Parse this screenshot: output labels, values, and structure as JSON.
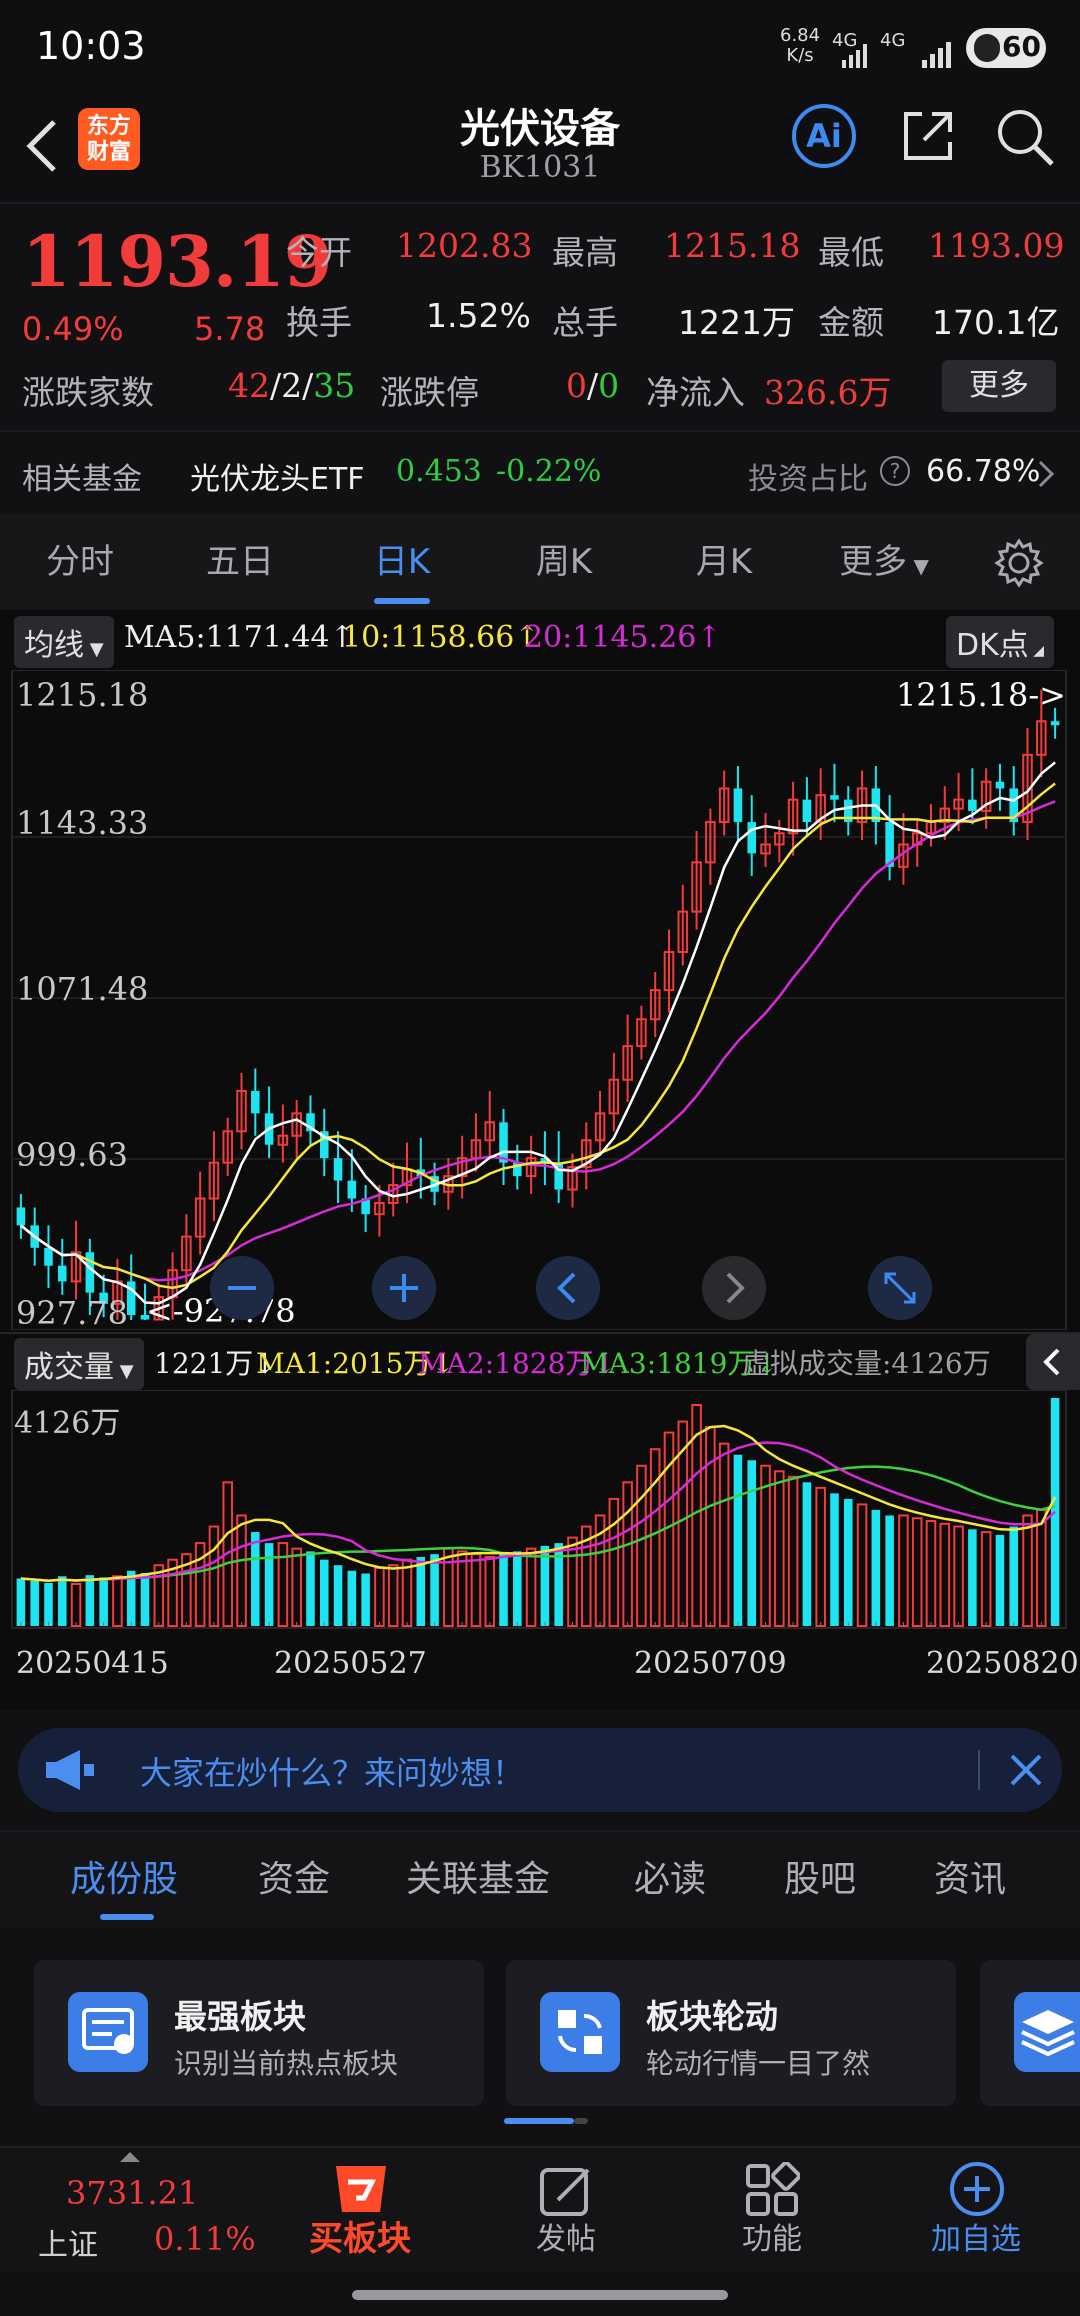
{
  "status_bar": {
    "time": "10:03",
    "net_speed_value": "6.84",
    "net_speed_unit": "K/s",
    "signal1_label": "4G",
    "signal2_label": "4G",
    "battery": "60"
  },
  "header": {
    "logo_line1": "东方",
    "logo_line2": "财富",
    "title": "光伏设备",
    "code": "BK1031",
    "ai_label": "Ai"
  },
  "quote": {
    "price": "1193.19",
    "change_pct": "0.49%",
    "change": "5.78",
    "open_label": "今开",
    "open": "1202.83",
    "high_label": "最高",
    "high": "1215.18",
    "low_label": "最低",
    "low": "1193.09",
    "turnover_label": "换手",
    "turnover": "1.52%",
    "volume_label": "总手",
    "volume": "1221万",
    "amount_label": "金额",
    "amount": "170.1亿",
    "advdec_label": "涨跌家数",
    "adv": "42",
    "sep1": "/",
    "flat": "2",
    "sep2": "/",
    "dec": "35",
    "limit_label": "涨跌停",
    "limit_up": "0",
    "limit_sep": "/",
    "limit_down": "0",
    "netflow_label": "净流入",
    "netflow": "326.6万",
    "more_label": "更多",
    "fund_label": "相关基金",
    "fund_name": "光伏龙头ETF",
    "fund_price": "0.453",
    "fund_change": "-0.22%",
    "invest_label": "投资占比",
    "invest_value": "66.78%"
  },
  "chart_tabs": [
    "分时",
    "五日",
    "日K",
    "周K",
    "月K",
    "更多"
  ],
  "chart_tab_active": 2,
  "ma_bar": {
    "selector": "均线",
    "ma5": "MA5:1171.44↑",
    "ma10": "10:1158.66↑",
    "ma20": "20:1145.26↑",
    "dk": "DK点"
  },
  "volume_bar": {
    "selector": "成交量",
    "vol": "1221万↓",
    "ma1": "MA1:2015万↓",
    "ma2": "MA2:1828万↓",
    "ma3": "MA3:1819万↓",
    "virtual": "虚拟成交量:4126万",
    "max_label": "4126万"
  },
  "chart_data": {
    "type": "candlestick",
    "price_ticks": [
      "1215.18",
      "1143.33",
      "1071.48",
      "999.63",
      "927.78"
    ],
    "ylim": [
      927.78,
      1215.18
    ],
    "high_marker": "1215.18->",
    "low_marker": "<-927.78",
    "x_ticks": [
      "20250415",
      "20250527",
      "20250709",
      "20250820"
    ],
    "colors": {
      "up": "#f23b3b",
      "down": "#1de4f0",
      "ma5": "#ffffff",
      "ma10": "#f5e83a",
      "ma20": "#d62bd6",
      "vol_ma3": "#3fcf3f"
    },
    "closes": [
      970,
      960,
      952,
      945,
      958,
      940,
      935,
      945,
      930,
      928,
      938,
      950,
      965,
      982,
      998,
      1012,
      1030,
      1020,
      1006,
      1010,
      1020,
      1012,
      1000,
      990,
      982,
      975,
      980,
      988,
      995,
      992,
      985,
      992,
      1000,
      1008,
      1016,
      998,
      992,
      1000,
      998,
      986,
      996,
      1008,
      1020,
      1035,
      1050,
      1062,
      1075,
      1092,
      1110,
      1132,
      1150,
      1165,
      1150,
      1136,
      1140,
      1145,
      1160,
      1150,
      1162,
      1160,
      1150,
      1165,
      1150,
      1130,
      1140,
      1145,
      1150,
      1156,
      1160,
      1155,
      1168,
      1165,
      1150,
      1180,
      1195,
      1193.19
    ],
    "volumes": [
      860,
      820,
      780,
      900,
      760,
      920,
      880,
      900,
      1000,
      960,
      1100,
      1200,
      1300,
      1500,
      1800,
      2600,
      2000,
      1700,
      1500,
      1500,
      1400,
      1350,
      1200,
      1100,
      1000,
      950,
      1050,
      1100,
      1200,
      1250,
      1300,
      1400,
      1350,
      1300,
      1250,
      1300,
      1350,
      1400,
      1450,
      1500,
      1600,
      1800,
      2000,
      2300,
      2600,
      2900,
      3200,
      3500,
      3700,
      4000,
      3600,
      3300,
      3100,
      3000,
      2900,
      2800,
      2700,
      2600,
      2500,
      2400,
      2300,
      2200,
      2100,
      2000,
      2000,
      1950,
      1900,
      1850,
      1800,
      1750,
      1700,
      1650,
      1800,
      2000,
      2100,
      4126
    ]
  },
  "chart_controls": [
    "zoom-out",
    "zoom-in",
    "prev",
    "next",
    "fullscreen"
  ],
  "banner": {
    "text": "大家在炒什么？来问妙想！"
  },
  "bottom_tabs": [
    "成份股",
    "资金",
    "关联基金",
    "必读",
    "股吧",
    "资讯"
  ],
  "bottom_tab_active": 0,
  "cards": [
    {
      "title": "最强板块",
      "subtitle": "识别当前热点板块"
    },
    {
      "title": "板块轮动",
      "subtitle": "轮动行情一目了然"
    }
  ],
  "footer": {
    "index_value": "3731.21",
    "index_name": "上证",
    "index_change": "0.11%",
    "buy_label": "买板块",
    "post_label": "发帖",
    "func_label": "功能",
    "add_label": "加自选"
  }
}
